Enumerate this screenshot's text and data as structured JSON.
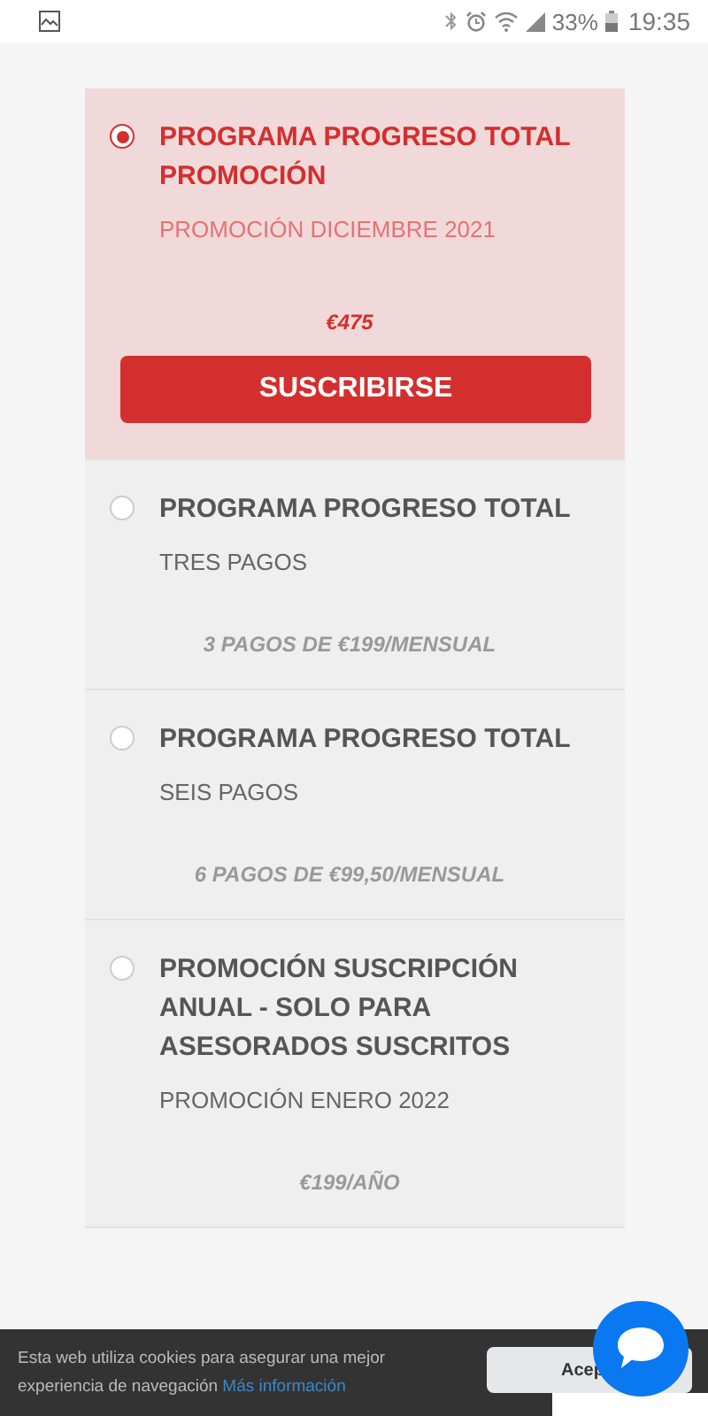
{
  "status_bar": {
    "battery": "33%",
    "time": "19:35"
  },
  "plans": [
    {
      "title": "PROGRAMA PROGRESO TOTAL PROMOCIÓN",
      "subtitle": "PROMOCIÓN DICIEMBRE 2021",
      "price": "€475",
      "selected": true,
      "button": "SUSCRIBIRSE"
    },
    {
      "title": "PROGRAMA PROGRESO TOTAL",
      "subtitle": "TRES PAGOS",
      "price": "3 PAGOS DE €199/MENSUAL",
      "selected": false
    },
    {
      "title": "PROGRAMA PROGRESO TOTAL",
      "subtitle": "SEIS PAGOS",
      "price": "6 PAGOS DE €99,50/MENSUAL",
      "selected": false
    },
    {
      "title": "PROMOCIÓN SUSCRIPCIÓN ANUAL - SOLO PARA ASESORADOS SUSCRITOS",
      "subtitle": "PROMOCIÓN ENERO 2022",
      "price": "€199/AÑO",
      "selected": false
    }
  ],
  "cookie_bar": {
    "text": "Esta web utiliza cookies para asegurar una mejor experiencia de navegación",
    "link": "Más información",
    "accept_button": "Acep"
  }
}
